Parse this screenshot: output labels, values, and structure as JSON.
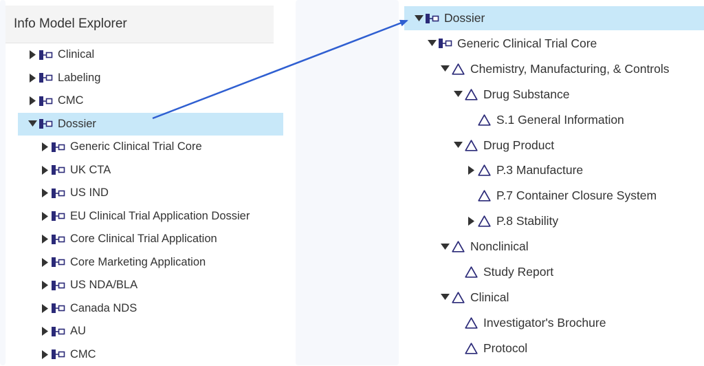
{
  "left": {
    "title": "Info Model Explorer",
    "items": [
      {
        "label": "Clinical",
        "level": 0,
        "expanded": false,
        "selected": false
      },
      {
        "label": "Labeling",
        "level": 0,
        "expanded": false,
        "selected": false
      },
      {
        "label": "CMC",
        "level": 0,
        "expanded": false,
        "selected": false
      },
      {
        "label": "Dossier",
        "level": 0,
        "expanded": true,
        "selected": true
      },
      {
        "label": "Generic Clinical Trial Core",
        "level": 1,
        "expanded": false,
        "selected": false
      },
      {
        "label": "UK CTA",
        "level": 1,
        "expanded": false,
        "selected": false
      },
      {
        "label": "US IND",
        "level": 1,
        "expanded": false,
        "selected": false
      },
      {
        "label": "EU Clinical Trial Application Dossier",
        "level": 1,
        "expanded": false,
        "selected": false
      },
      {
        "label": "Core Clinical Trial Application",
        "level": 1,
        "expanded": false,
        "selected": false
      },
      {
        "label": "Core Marketing Application",
        "level": 1,
        "expanded": false,
        "selected": false
      },
      {
        "label": "US NDA/BLA",
        "level": 1,
        "expanded": false,
        "selected": false
      },
      {
        "label": "Canada NDS",
        "level": 1,
        "expanded": false,
        "selected": false
      },
      {
        "label": "AU",
        "level": 1,
        "expanded": false,
        "selected": false
      },
      {
        "label": "CMC",
        "level": 1,
        "expanded": false,
        "selected": false
      }
    ]
  },
  "right": {
    "items": [
      {
        "label": "Dossier",
        "level": 0,
        "caret": "down",
        "icon": "node",
        "selected": true
      },
      {
        "label": "Generic Clinical Trial Core",
        "level": 1,
        "caret": "down",
        "icon": "node",
        "selected": false
      },
      {
        "label": "Chemistry, Manufacturing, & Controls",
        "level": 2,
        "caret": "down",
        "icon": "triangle",
        "selected": false
      },
      {
        "label": "Drug Substance",
        "level": 3,
        "caret": "down",
        "icon": "triangle",
        "selected": false
      },
      {
        "label": "S.1 General Information",
        "level": 4,
        "caret": "none",
        "icon": "triangle",
        "selected": false
      },
      {
        "label": "Drug Product",
        "level": 3,
        "caret": "down",
        "icon": "triangle",
        "selected": false
      },
      {
        "label": "P.3 Manufacture",
        "level": 4,
        "caret": "right",
        "icon": "triangle",
        "selected": false
      },
      {
        "label": "P.7 Container Closure System",
        "level": 4,
        "caret": "none",
        "icon": "triangle",
        "selected": false
      },
      {
        "label": "P.8 Stability",
        "level": 4,
        "caret": "right",
        "icon": "triangle",
        "selected": false
      },
      {
        "label": "Nonclinical",
        "level": 2,
        "caret": "down",
        "icon": "triangle",
        "selected": false
      },
      {
        "label": "Study Report",
        "level": 3,
        "caret": "none",
        "icon": "triangle",
        "selected": false
      },
      {
        "label": "Clinical",
        "level": 2,
        "caret": "down",
        "icon": "triangle",
        "selected": false
      },
      {
        "label": "Investigator's Brochure",
        "level": 3,
        "caret": "none",
        "icon": "triangle",
        "selected": false
      },
      {
        "label": "Protocol",
        "level": 3,
        "caret": "none",
        "icon": "triangle",
        "selected": false
      }
    ]
  },
  "colors": {
    "selected_bg": "#c8e8f9",
    "icon_navy": "#2b2a78",
    "arrow_blue": "#2f5fd1",
    "header_bg": "#f4f4f4"
  },
  "icons": {
    "caret_right": "caret-right-icon",
    "caret_down": "caret-down-icon",
    "node": "info-model-node-icon",
    "triangle": "delta-triangle-icon"
  }
}
